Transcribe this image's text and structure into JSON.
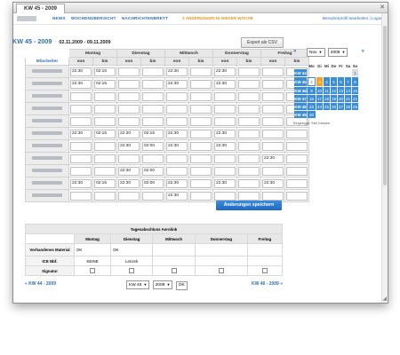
{
  "window": {
    "tab_title": "KW 45 - 2009"
  },
  "nav": {
    "items": [
      "NEWS",
      "WOCHENÜBERSICHT",
      "NACHRICHTENBRETT"
    ],
    "news_notice": "3 ÄNDERUNGEN IN DIESER WOCHE",
    "profile_link": "Benutzerprofil bearbeiten",
    "separator": "|",
    "logout_link": "Logout"
  },
  "page": {
    "title": "KW 45 - 2009",
    "date_range": "02.11.2009 - 09.11.2009",
    "export_label": "Export als CSV",
    "save_label": "Änderungen speichern"
  },
  "schedule": {
    "days": [
      "Montag",
      "Dienstag",
      "Mittwoch",
      "Donnerstag",
      "Freitag"
    ],
    "staff_header": "Mitarbeiter",
    "von": "von",
    "bis": "bis",
    "rows": [
      [
        "22:30",
        "02:15",
        "",
        "",
        "22:30",
        "",
        "22:30",
        "",
        "",
        ""
      ],
      [
        "22:30",
        "02:15",
        "",
        "",
        "22:30",
        "",
        "22:30",
        "",
        "",
        ""
      ],
      [
        "",
        "",
        "",
        "",
        "",
        "",
        "",
        "",
        "",
        ""
      ],
      [
        "",
        "",
        "",
        "",
        "",
        "",
        "",
        "",
        "",
        ""
      ],
      [
        "",
        "",
        "",
        "",
        "",
        "",
        "",
        "",
        "",
        ""
      ],
      [
        "22:30",
        "02:15",
        "22:30",
        "02:15",
        "22:30",
        "",
        "22:30",
        "",
        "",
        ""
      ],
      [
        "",
        "",
        "22:30",
        "02:00",
        "22:30",
        "",
        "22:30",
        "",
        "",
        ""
      ],
      [
        "",
        "",
        "",
        "",
        "",
        "",
        "",
        "",
        "22:30",
        ""
      ],
      [
        "",
        "",
        "22:30",
        "02:00",
        "",
        "",
        "",
        "",
        "",
        ""
      ],
      [
        "22:30",
        "02:15",
        "22:30",
        "02:00",
        "22:30",
        "",
        "22:30",
        "",
        "22:30",
        ""
      ],
      [
        "",
        "",
        "",
        "",
        "22:30",
        "",
        "",
        "",
        "",
        ""
      ]
    ]
  },
  "daily": {
    "title": "Tagesabschluss Aerolink",
    "days": [
      "Montag",
      "Dienstag",
      "Mittwoch",
      "Donnerstag",
      "Freitag"
    ],
    "row_labels": [
      "Vorhandenes Material",
      "ICE Nbf.",
      "Signatur"
    ],
    "material": [
      "OK",
      "OK",
      "",
      "",
      ""
    ],
    "ice": [
      "KEINE",
      "Lenzek",
      "",
      "",
      ""
    ]
  },
  "pager": {
    "prev": "« KW 44 - 2009",
    "next": "KW 46 - 2009 »",
    "week": "KW 45",
    "year": "2009",
    "ok": "OK"
  },
  "calendar": {
    "prev": "«",
    "next": "»",
    "month": "Nov",
    "year": "2009",
    "day_headers": [
      "Mo",
      "Di",
      "Mi",
      "Do",
      "Fr",
      "Sa",
      "So"
    ],
    "weeks": [
      {
        "kw": "KW 44",
        "days": [
          "",
          "",
          "",
          "",
          "",
          "",
          "1"
        ]
      },
      {
        "kw": "KW 45",
        "days": [
          "2",
          "3",
          "4",
          "5",
          "6",
          "7",
          "8"
        ]
      },
      {
        "kw": "KW 46",
        "days": [
          "9",
          "10",
          "11",
          "12",
          "13",
          "14",
          "15"
        ]
      },
      {
        "kw": "KW 47",
        "days": [
          "16",
          "17",
          "18",
          "19",
          "20",
          "21",
          "22"
        ]
      },
      {
        "kw": "KW 48",
        "days": [
          "23",
          "24",
          "25",
          "26",
          "27",
          "28",
          "29"
        ]
      },
      {
        "kw": "KW 49",
        "days": [
          "30",
          "",
          "",
          "",
          "",
          "",
          ""
        ]
      }
    ],
    "logged_in": "Eingeloggt: Stef Gessen"
  }
}
